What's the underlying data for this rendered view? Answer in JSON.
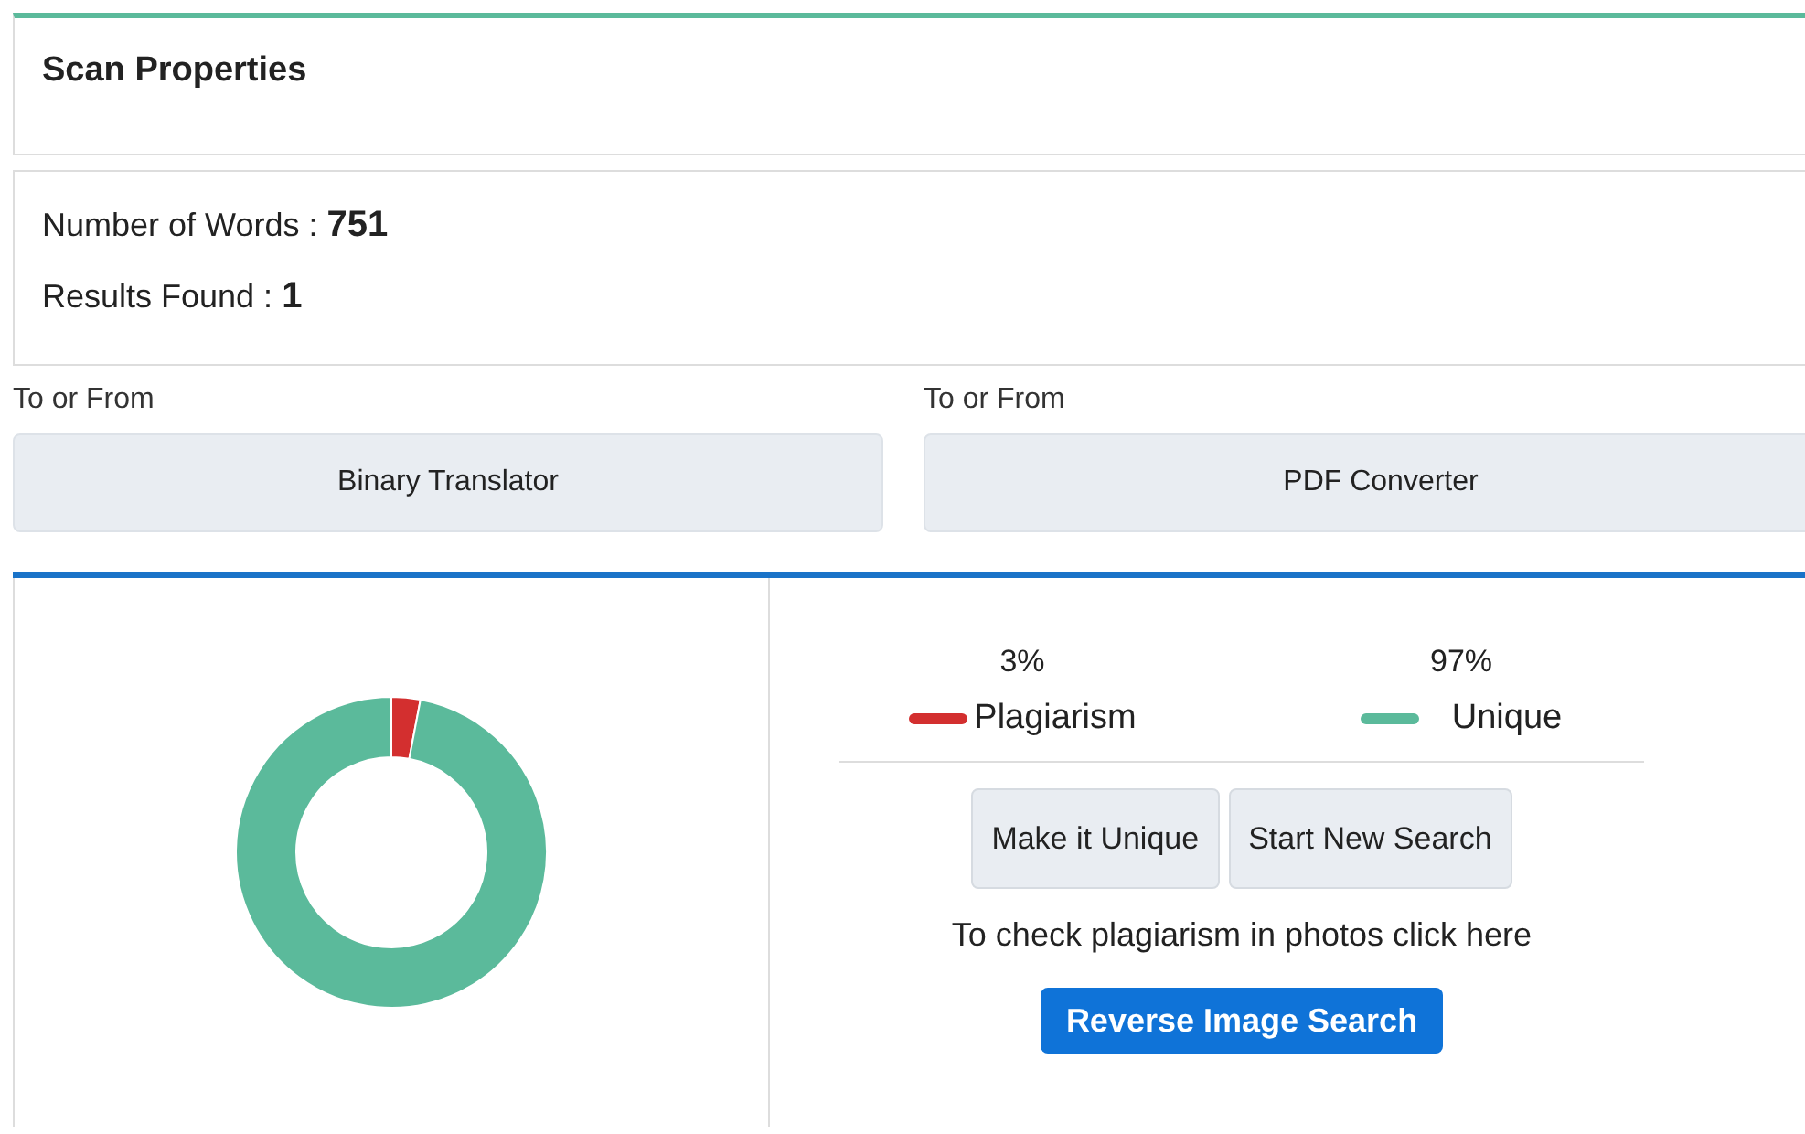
{
  "scan_properties": {
    "title": "Scan Properties"
  },
  "stats": [
    "Number of Words : **751**",
    "Results Found : **1**"
  ],
  "converters": [
    {
      "caption": "To or From",
      "button": "Binary Translator"
    },
    {
      "caption": "To or From",
      "button": "PDF Converter"
    }
  ],
  "result": {
    "chart_data": {
      "type": "donut",
      "categories": [
        "Plagiarism",
        "Unique"
      ],
      "values": [
        3,
        97
      ]
    },
    "legend": [
      {
        "percent": "3%",
        "color": "#d32f2f"
      },
      {
        "percent": "97%",
        "color": "#5bba9b"
      }
    ],
    "buttons": [
      "Make it Unique",
      "Start New Search"
    ],
    "hint": "To check plagiarism in photos click here",
    "primary_button": "Reverse Image Search"
  }
}
